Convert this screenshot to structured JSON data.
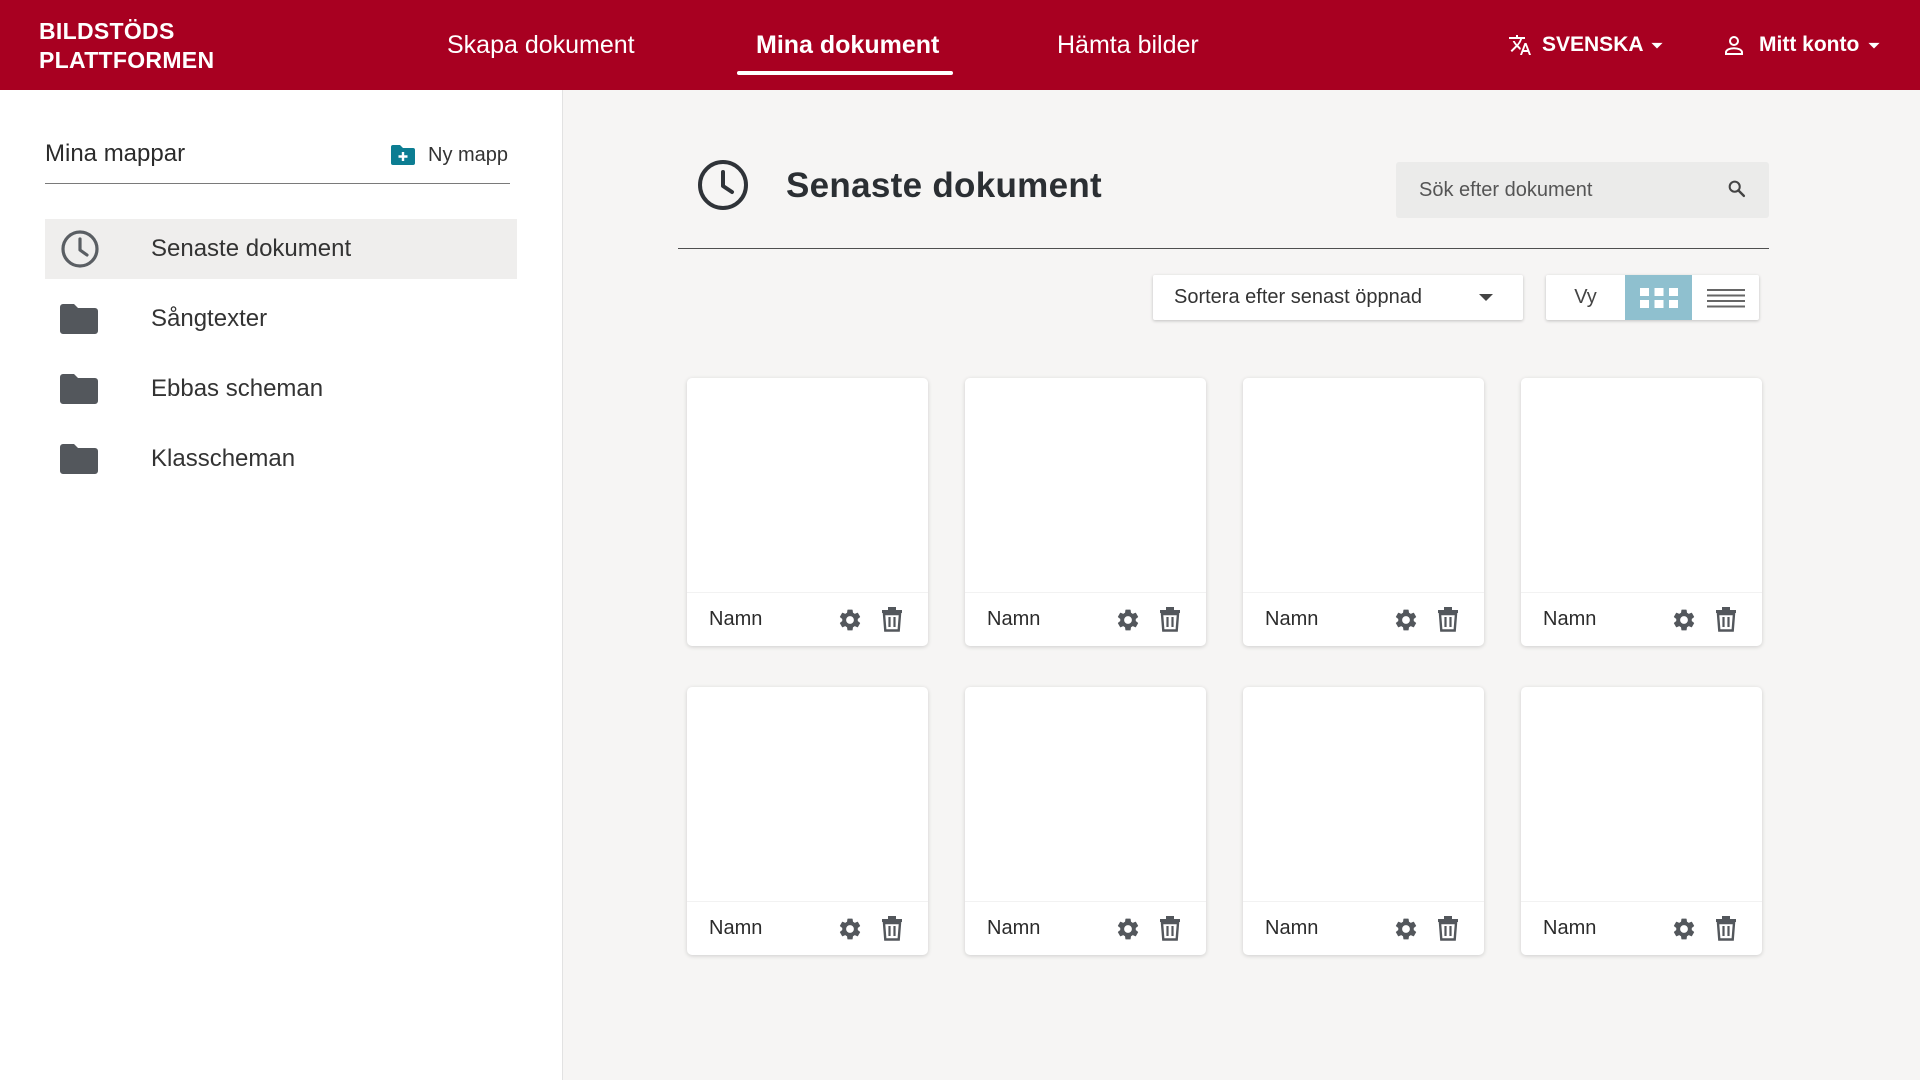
{
  "header": {
    "brand_line1": "BILDSTÖDS",
    "brand_line2": "PLATTFORMEN",
    "nav": [
      {
        "label": "Skapa dokument"
      },
      {
        "label": "Mina dokument"
      },
      {
        "label": "Hämta bilder"
      }
    ],
    "language": "SVENSKA",
    "account": "Mitt konto",
    "brand_color": "#a80021"
  },
  "sidebar": {
    "title": "Mina mappar",
    "new_folder_label": "Ny mapp",
    "items": [
      {
        "label": "Senaste dokument",
        "icon": "clock-icon"
      },
      {
        "label": "Sångtexter",
        "icon": "folder-icon"
      },
      {
        "label": "Ebbas scheman",
        "icon": "folder-icon"
      },
      {
        "label": "Klasscheman",
        "icon": "folder-icon"
      }
    ]
  },
  "main": {
    "title": "Senaste dokument",
    "search_placeholder": "Sök efter dokument",
    "sort_label": "Sortera efter senast öppnad",
    "view_label": "Vy",
    "active_view": "grid",
    "accent_color": "#8fc0cf",
    "documents": [
      {
        "name": "Namn"
      },
      {
        "name": "Namn"
      },
      {
        "name": "Namn"
      },
      {
        "name": "Namn"
      },
      {
        "name": "Namn"
      },
      {
        "name": "Namn"
      },
      {
        "name": "Namn"
      },
      {
        "name": "Namn"
      }
    ]
  }
}
